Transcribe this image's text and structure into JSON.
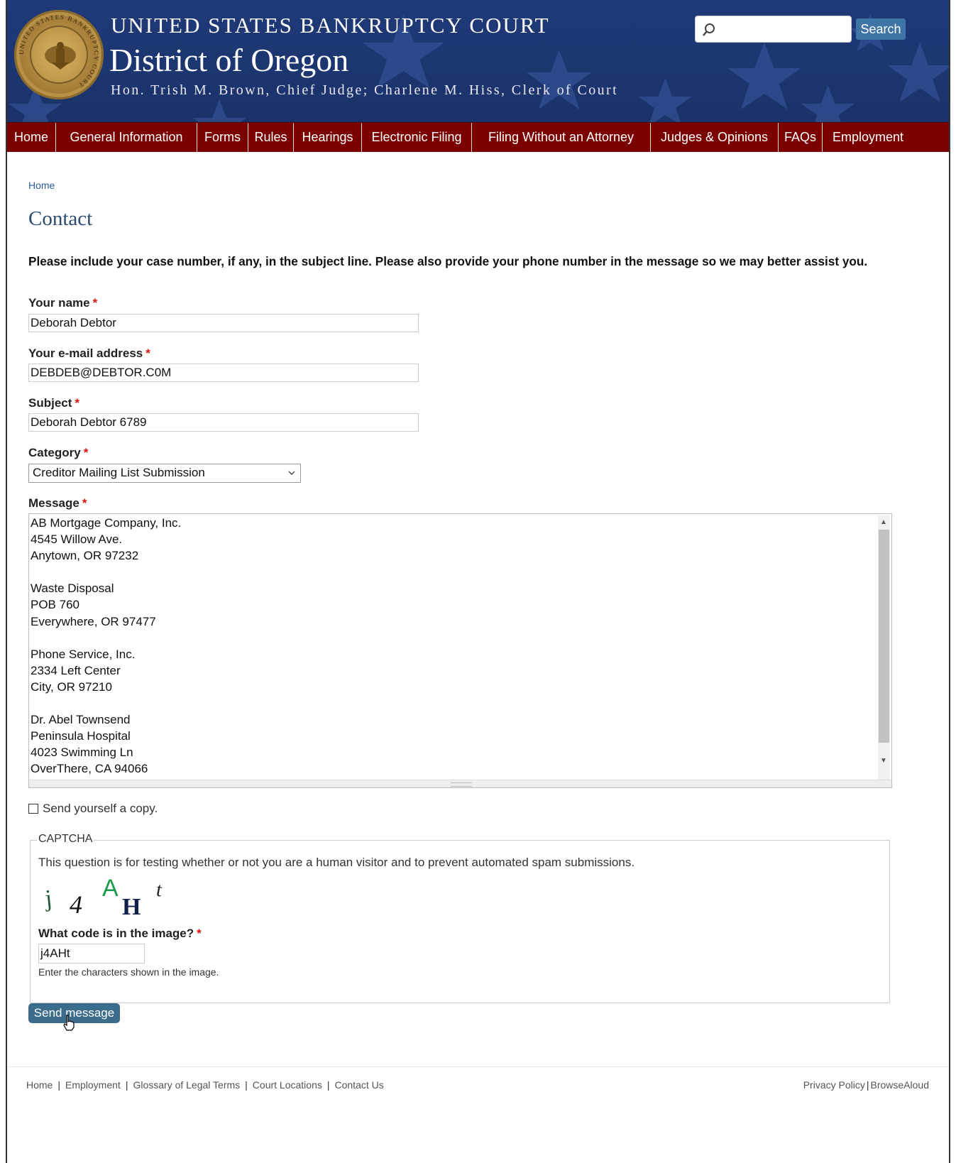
{
  "header": {
    "seal_text": "UNITED STATES BANKRUPTCY COURT",
    "court_name": "UNITED STATES BANKRUPTCY COURT",
    "district": "District of Oregon",
    "judges": "Hon. Trish M. Brown, Chief Judge; Charlene M. Hiss, Clerk of Court",
    "search": {
      "placeholder": "",
      "button_label": "Search"
    }
  },
  "nav": {
    "items": [
      {
        "label": "Home"
      },
      {
        "label": "General Information"
      },
      {
        "label": "Forms"
      },
      {
        "label": "Rules"
      },
      {
        "label": "Hearings"
      },
      {
        "label": "Electronic Filing"
      },
      {
        "label": "Filing Without an Attorney"
      },
      {
        "label": "Judges & Opinions"
      },
      {
        "label": "FAQs"
      },
      {
        "label": "Employment"
      }
    ]
  },
  "breadcrumb": "Home",
  "page_title": "Contact",
  "intro": "Please include your case number, if any, in the subject line.  Please also provide your phone number in the message so we may better assist you.",
  "form": {
    "name": {
      "label": "Your name",
      "required": "*",
      "value": "Deborah Debtor"
    },
    "email": {
      "label": "Your e-mail address",
      "required": "*",
      "value": "DEBDEB@DEBTOR.C0M"
    },
    "subject": {
      "label": "Subject",
      "required": "*",
      "value": "Deborah Debtor 6789"
    },
    "category": {
      "label": "Category",
      "required": "*",
      "value": "Creditor Mailing List Submission"
    },
    "message": {
      "label": "Message",
      "required": "*",
      "value": "AB Mortgage Company, Inc.\n4545 Willow Ave.\nAnytown, OR 97232\n\nWaste Disposal\nPOB 760\nEverywhere, OR 97477\n\nPhone Service, Inc.\n2334 Left Center\nCity, OR 97210\n\nDr. Abel Townsend\nPeninsula Hospital\n4023 Swimming Ln\nOverThere, CA 94066"
    },
    "copy_label": "Send yourself a copy.",
    "captcha": {
      "legend": "CAPTCHA",
      "description": "This question is for testing whether or not you are a human visitor and to prevent automated spam submissions.",
      "image_text": "j4AHt",
      "label": "What code is in the image?",
      "required": "*",
      "value": "j4AHt",
      "hint": "Enter the characters shown in the image."
    },
    "submit_label": "Send message"
  },
  "footer": {
    "left_links": [
      {
        "label": "Home"
      },
      {
        "label": "Employment"
      },
      {
        "label": "Glossary of Legal Terms"
      },
      {
        "label": "Court Locations"
      },
      {
        "label": "Contact Us"
      }
    ],
    "right_links": [
      {
        "label": "Privacy Policy"
      },
      {
        "label": "BrowseAloud"
      }
    ]
  },
  "colors": {
    "header_blue": "#1d3873",
    "nav_red": "#7b0000",
    "button_blue": "#3b6c8c",
    "required_red": "#dd1111"
  }
}
